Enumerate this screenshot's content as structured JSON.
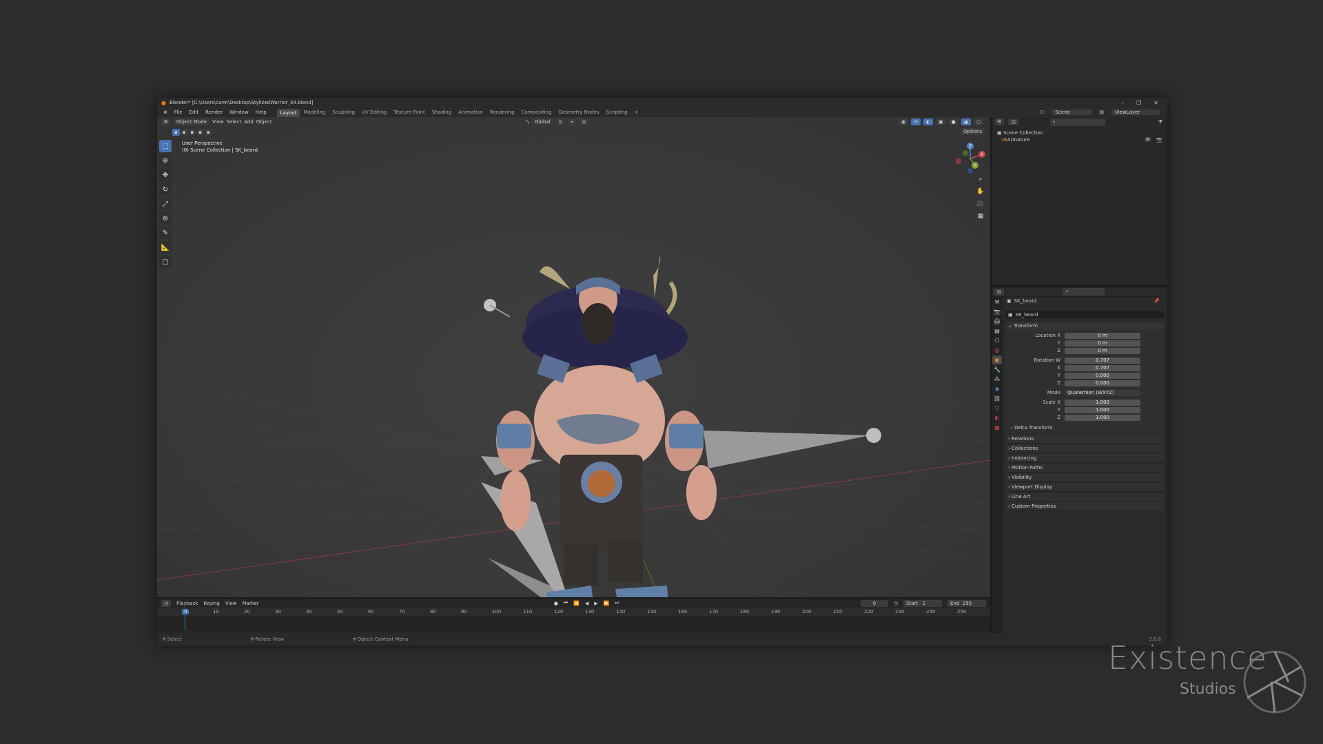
{
  "window": {
    "title": "Blender* [C:\\Users\\carm\\Desktop\\StylizedWarrior_04.blend]",
    "controls": [
      "–",
      "❐",
      "✕"
    ]
  },
  "menu": {
    "items": [
      "File",
      "Edit",
      "Render",
      "Window",
      "Help"
    ],
    "workspaces": [
      "Layout",
      "Modeling",
      "Sculpting",
      "UV Editing",
      "Texture Paint",
      "Shading",
      "Animation",
      "Rendering",
      "Compositing",
      "Geometry Nodes",
      "Scripting"
    ],
    "add_tab": "+"
  },
  "viewport": {
    "mode": "Object Mode",
    "menus": [
      "View",
      "Select",
      "Add",
      "Object"
    ],
    "orientation": "Global",
    "options": "Options",
    "info_line1": "User Perspective",
    "info_line2": "(0) Scene Collection | SK_beard",
    "gizmo_labels": [
      "X",
      "Y",
      "Z"
    ]
  },
  "topright": {
    "scene_label": "Scene",
    "viewlayer_label": "ViewLayer"
  },
  "outliner": {
    "root": "Scene Collection",
    "items": [
      "Armature"
    ]
  },
  "properties": {
    "object_name": "SK_beard",
    "data_name": "SK_beard",
    "transform_header": "Transform",
    "location_label": "Location X",
    "location": [
      "0 m",
      "0 m",
      "0 m"
    ],
    "rotation_label": "Rotation W",
    "rotation": [
      "0.707",
      "0.707",
      "0.000",
      "0.000"
    ],
    "mode_label": "Mode",
    "mode_value": "Quaternion (WXYZ)",
    "scale_label": "Scale X",
    "scale": [
      "1.000",
      "1.000",
      "1.000"
    ],
    "axis_y": "Y",
    "axis_x": "X",
    "axis_z": "Z",
    "delta": "Delta Transform",
    "panels": [
      "Relations",
      "Collections",
      "Instancing",
      "Motion Paths",
      "Visibility",
      "Viewport Display",
      "Line Art",
      "Custom Properties"
    ]
  },
  "timeline": {
    "menus": [
      "Playback",
      "Keying",
      "View",
      "Marker"
    ],
    "current_frame": "0",
    "start_label": "Start",
    "start": "1",
    "end_label": "End",
    "end": "250",
    "ticks": [
      "0",
      "10",
      "20",
      "30",
      "40",
      "50",
      "60",
      "70",
      "80",
      "90",
      "100",
      "110",
      "120",
      "130",
      "140",
      "150",
      "160",
      "170",
      "180",
      "190",
      "200",
      "210",
      "220",
      "230",
      "240",
      "250"
    ]
  },
  "statusbar": {
    "items": [
      "Select",
      "Rotate View",
      "Object Context Menu"
    ],
    "version": "3.6.8"
  },
  "watermark": {
    "title": "Existence",
    "subtitle": "Studios"
  },
  "colors": {
    "accent": "#4772b3",
    "background": "#2c2c2c",
    "x_axis": "#c8464f",
    "y_axis": "#7fa33a",
    "z_axis": "#4b80c4"
  }
}
